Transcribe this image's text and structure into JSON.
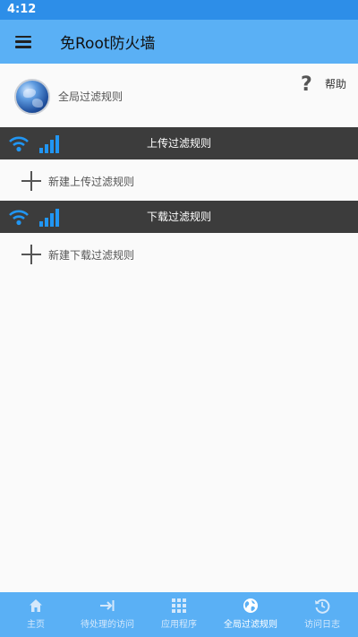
{
  "status_bar": {
    "time": "4:12"
  },
  "app_bar": {
    "title": "免Root防火墙",
    "menu_icon": "hamburger-menu-icon"
  },
  "header": {
    "label": "全局过滤规则",
    "help_label": "帮助",
    "help_icon": "question-mark-icon",
    "globe_icon": "globe-icon"
  },
  "upload_section": {
    "title": "上传过滤规则",
    "add_label": "新建上传过滤规则"
  },
  "download_section": {
    "title": "下载过滤规则",
    "add_label": "新建下载过滤规则"
  },
  "bottom_nav": {
    "items": [
      {
        "label": "主页",
        "icon": "home-icon"
      },
      {
        "label": "待处理的访问",
        "icon": "arrow-right-bar-icon"
      },
      {
        "label": "应用程序",
        "icon": "grid-icon"
      },
      {
        "label": "全局过滤规则",
        "icon": "globe-icon",
        "active": true
      },
      {
        "label": "访问日志",
        "icon": "history-icon"
      }
    ]
  },
  "colors": {
    "accent": "#5ab0f5",
    "status_bar": "#2d8ee8",
    "section_bar": "#3c3c3c",
    "icon_blue": "#2196f3"
  }
}
